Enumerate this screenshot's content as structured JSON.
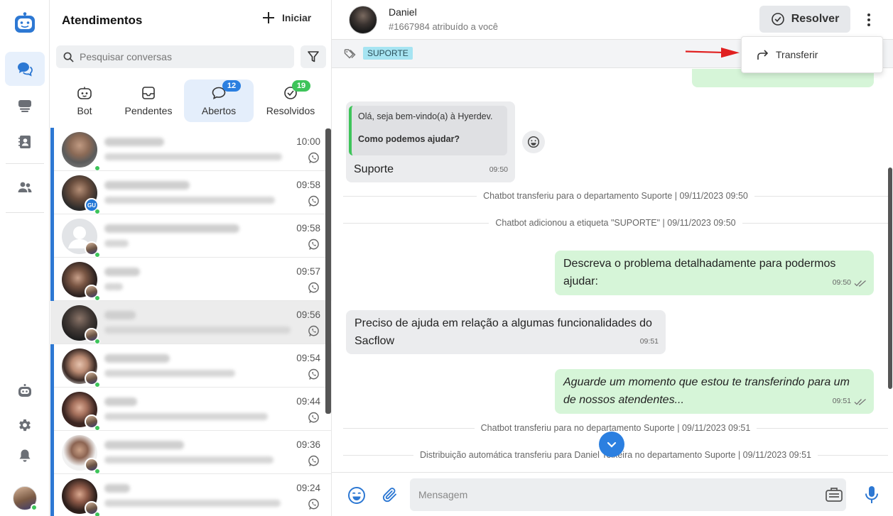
{
  "sidebar": {
    "items": [
      {
        "name": "chat-icon",
        "active": true
      },
      {
        "name": "inbox-icon",
        "active": false
      },
      {
        "name": "contacts-icon",
        "active": false
      },
      {
        "name": "team-icon",
        "active": false
      },
      {
        "name": "bot-icon",
        "active": false
      },
      {
        "name": "gear-icon",
        "active": false
      },
      {
        "name": "bell-icon",
        "active": false
      }
    ]
  },
  "list": {
    "title": "Atendimentos",
    "new_label": "Iniciar",
    "search_placeholder": "Pesquisar conversas",
    "tabs": [
      {
        "label": "Bot",
        "icon": "bot-icon",
        "badge": ""
      },
      {
        "label": "Pendentes",
        "icon": "inbox-icon",
        "badge": ""
      },
      {
        "label": "Abertos",
        "icon": "chat-bubble-icon",
        "badge": "12",
        "badge_color": "#2b7fe0"
      },
      {
        "label": "Resolvidos",
        "icon": "check-circle-icon",
        "badge": "19",
        "badge_color": "#3ec45a"
      }
    ],
    "rows": [
      {
        "time": "10:00"
      },
      {
        "time": "09:58",
        "sub_badge": "GU"
      },
      {
        "time": "09:58"
      },
      {
        "time": "09:57"
      },
      {
        "time": "09:56",
        "selected": true
      },
      {
        "time": "09:54"
      },
      {
        "time": "09:44"
      },
      {
        "time": "09:36"
      },
      {
        "time": "09:24"
      }
    ]
  },
  "header": {
    "name": "Daniel",
    "subtitle": "#1667984 atribuído a você",
    "resolve_label": "Resolver",
    "tag": "SUPORTE"
  },
  "menu": {
    "transfer_label": "Transferir"
  },
  "chat": {
    "quoted_greeting": "Olá, seja bem-vindo(a) à Hyerdev.",
    "quoted_question": "Como podemos ajudar?",
    "reply_text": "Suporte",
    "reply_time": "09:50",
    "sys1": "Chatbot transferiu para o departamento Suporte | 09/11/2023 09:50",
    "sys2": "Chatbot adicionou a etiqueta \"SUPORTE\" | 09/11/2023 09:50",
    "out1_line1": "Descreva o problema detalhadamente para podermos",
    "out1_line2": "ajudar:",
    "out1_time": "09:50",
    "in2_line1": "Preciso de ajuda em relação a algumas funcionalidades do",
    "in2_line2": "Sacflow",
    "in2_time": "09:51",
    "out2_line1": "Aguarde um momento que estou te transferindo para um",
    "out2_line2": "de nossos atendentes...",
    "out2_time": "09:51",
    "sys3": "Chatbot transferiu para no departamento Suporte | 09/11/2023 09:51",
    "sys4": "Distribuição automática transferiu para Daniel Teixeira no departamento Suporte | 09/11/2023 09:51"
  },
  "composer": {
    "placeholder": "Mensagem"
  },
  "colors": {
    "accent": "#2b7fe0",
    "online": "#3ec45a",
    "out_bubble": "#d6f5d8",
    "in_bubble": "#ebecee",
    "tag": "#a6e4f2"
  }
}
